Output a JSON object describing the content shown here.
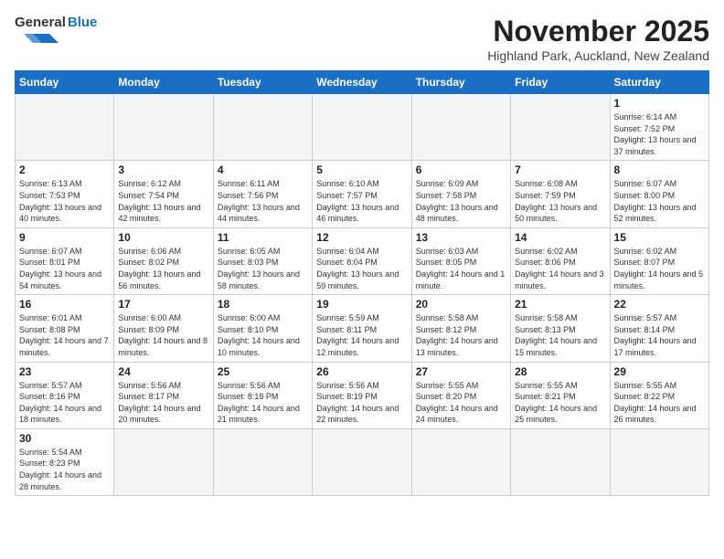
{
  "header": {
    "logo_general": "General",
    "logo_blue": "Blue",
    "title": "November 2025",
    "location": "Highland Park, Auckland, New Zealand"
  },
  "days": [
    "Sunday",
    "Monday",
    "Tuesday",
    "Wednesday",
    "Thursday",
    "Friday",
    "Saturday"
  ],
  "cells": [
    {
      "day": "",
      "empty": true
    },
    {
      "day": "",
      "empty": true
    },
    {
      "day": "",
      "empty": true
    },
    {
      "day": "",
      "empty": true
    },
    {
      "day": "",
      "empty": true
    },
    {
      "day": "",
      "empty": true
    },
    {
      "day": "1",
      "sunrise": "Sunrise: 6:14 AM",
      "sunset": "Sunset: 7:52 PM",
      "daylight": "Daylight: 13 hours and 37 minutes."
    },
    {
      "day": "2",
      "sunrise": "Sunrise: 6:13 AM",
      "sunset": "Sunset: 7:53 PM",
      "daylight": "Daylight: 13 hours and 40 minutes."
    },
    {
      "day": "3",
      "sunrise": "Sunrise: 6:12 AM",
      "sunset": "Sunset: 7:54 PM",
      "daylight": "Daylight: 13 hours and 42 minutes."
    },
    {
      "day": "4",
      "sunrise": "Sunrise: 6:11 AM",
      "sunset": "Sunset: 7:56 PM",
      "daylight": "Daylight: 13 hours and 44 minutes."
    },
    {
      "day": "5",
      "sunrise": "Sunrise: 6:10 AM",
      "sunset": "Sunset: 7:57 PM",
      "daylight": "Daylight: 13 hours and 46 minutes."
    },
    {
      "day": "6",
      "sunrise": "Sunrise: 6:09 AM",
      "sunset": "Sunset: 7:58 PM",
      "daylight": "Daylight: 13 hours and 48 minutes."
    },
    {
      "day": "7",
      "sunrise": "Sunrise: 6:08 AM",
      "sunset": "Sunset: 7:59 PM",
      "daylight": "Daylight: 13 hours and 50 minutes."
    },
    {
      "day": "8",
      "sunrise": "Sunrise: 6:07 AM",
      "sunset": "Sunset: 8:00 PM",
      "daylight": "Daylight: 13 hours and 52 minutes."
    },
    {
      "day": "9",
      "sunrise": "Sunrise: 6:07 AM",
      "sunset": "Sunset: 8:01 PM",
      "daylight": "Daylight: 13 hours and 54 minutes."
    },
    {
      "day": "10",
      "sunrise": "Sunrise: 6:06 AM",
      "sunset": "Sunset: 8:02 PM",
      "daylight": "Daylight: 13 hours and 56 minutes."
    },
    {
      "day": "11",
      "sunrise": "Sunrise: 6:05 AM",
      "sunset": "Sunset: 8:03 PM",
      "daylight": "Daylight: 13 hours and 58 minutes."
    },
    {
      "day": "12",
      "sunrise": "Sunrise: 6:04 AM",
      "sunset": "Sunset: 8:04 PM",
      "daylight": "Daylight: 13 hours and 59 minutes."
    },
    {
      "day": "13",
      "sunrise": "Sunrise: 6:03 AM",
      "sunset": "Sunset: 8:05 PM",
      "daylight": "Daylight: 14 hours and 1 minute."
    },
    {
      "day": "14",
      "sunrise": "Sunrise: 6:02 AM",
      "sunset": "Sunset: 8:06 PM",
      "daylight": "Daylight: 14 hours and 3 minutes."
    },
    {
      "day": "15",
      "sunrise": "Sunrise: 6:02 AM",
      "sunset": "Sunset: 8:07 PM",
      "daylight": "Daylight: 14 hours and 5 minutes."
    },
    {
      "day": "16",
      "sunrise": "Sunrise: 6:01 AM",
      "sunset": "Sunset: 8:08 PM",
      "daylight": "Daylight: 14 hours and 7 minutes."
    },
    {
      "day": "17",
      "sunrise": "Sunrise: 6:00 AM",
      "sunset": "Sunset: 8:09 PM",
      "daylight": "Daylight: 14 hours and 8 minutes."
    },
    {
      "day": "18",
      "sunrise": "Sunrise: 6:00 AM",
      "sunset": "Sunset: 8:10 PM",
      "daylight": "Daylight: 14 hours and 10 minutes."
    },
    {
      "day": "19",
      "sunrise": "Sunrise: 5:59 AM",
      "sunset": "Sunset: 8:11 PM",
      "daylight": "Daylight: 14 hours and 12 minutes."
    },
    {
      "day": "20",
      "sunrise": "Sunrise: 5:58 AM",
      "sunset": "Sunset: 8:12 PM",
      "daylight": "Daylight: 14 hours and 13 minutes."
    },
    {
      "day": "21",
      "sunrise": "Sunrise: 5:58 AM",
      "sunset": "Sunset: 8:13 PM",
      "daylight": "Daylight: 14 hours and 15 minutes."
    },
    {
      "day": "22",
      "sunrise": "Sunrise: 5:57 AM",
      "sunset": "Sunset: 8:14 PM",
      "daylight": "Daylight: 14 hours and 17 minutes."
    },
    {
      "day": "23",
      "sunrise": "Sunrise: 5:57 AM",
      "sunset": "Sunset: 8:16 PM",
      "daylight": "Daylight: 14 hours and 18 minutes."
    },
    {
      "day": "24",
      "sunrise": "Sunrise: 5:56 AM",
      "sunset": "Sunset: 8:17 PM",
      "daylight": "Daylight: 14 hours and 20 minutes."
    },
    {
      "day": "25",
      "sunrise": "Sunrise: 5:56 AM",
      "sunset": "Sunset: 8:18 PM",
      "daylight": "Daylight: 14 hours and 21 minutes."
    },
    {
      "day": "26",
      "sunrise": "Sunrise: 5:56 AM",
      "sunset": "Sunset: 8:19 PM",
      "daylight": "Daylight: 14 hours and 22 minutes."
    },
    {
      "day": "27",
      "sunrise": "Sunrise: 5:55 AM",
      "sunset": "Sunset: 8:20 PM",
      "daylight": "Daylight: 14 hours and 24 minutes."
    },
    {
      "day": "28",
      "sunrise": "Sunrise: 5:55 AM",
      "sunset": "Sunset: 8:21 PM",
      "daylight": "Daylight: 14 hours and 25 minutes."
    },
    {
      "day": "29",
      "sunrise": "Sunrise: 5:55 AM",
      "sunset": "Sunset: 8:22 PM",
      "daylight": "Daylight: 14 hours and 26 minutes."
    },
    {
      "day": "30",
      "sunrise": "Sunrise: 5:54 AM",
      "sunset": "Sunset: 8:23 PM",
      "daylight": "Daylight: 14 hours and 28 minutes."
    },
    {
      "day": "",
      "empty": true
    },
    {
      "day": "",
      "empty": true
    },
    {
      "day": "",
      "empty": true
    },
    {
      "day": "",
      "empty": true
    },
    {
      "day": "",
      "empty": true
    },
    {
      "day": "",
      "empty": true
    }
  ]
}
